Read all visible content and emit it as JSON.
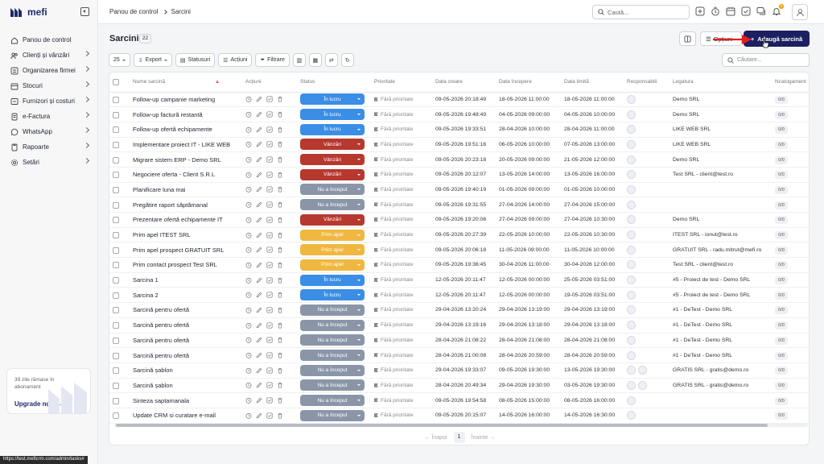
{
  "app": {
    "name": "mefi"
  },
  "sidebar": {
    "items": [
      {
        "label": "Panou de control",
        "icon": "home-icon",
        "chevron": false
      },
      {
        "label": "Clienți și vânzări",
        "icon": "users-icon",
        "chevron": true
      },
      {
        "label": "Organizarea firmei",
        "icon": "org-icon",
        "chevron": true
      },
      {
        "label": "Stocuri",
        "icon": "box-icon",
        "chevron": true
      },
      {
        "label": "Furnizori și costuri",
        "icon": "truck-icon",
        "chevron": true
      },
      {
        "label": "e-Factura",
        "icon": "invoice-icon",
        "chevron": true
      },
      {
        "label": "WhatsApp",
        "icon": "whatsapp-icon",
        "chevron": true
      },
      {
        "label": "Rapoarte",
        "icon": "report-icon",
        "chevron": true
      },
      {
        "label": "Setări",
        "icon": "gear-icon",
        "chevron": true
      }
    ],
    "upgrade": {
      "text": "39 zile rămase în abonament",
      "cta": "Upgrade now"
    }
  },
  "topbar": {
    "breadcrumb": [
      "Panou de control",
      "Sarcini"
    ],
    "search_placeholder": "Caută...",
    "notification_count": "3"
  },
  "page": {
    "title": "Sarcini",
    "count": "22",
    "options_label": "Opțiuni",
    "add_label": "Adaugă sarcină"
  },
  "toolbar": {
    "page_size": "25",
    "export": "Export",
    "statuses": "Statusuri",
    "actions": "Acțiuni",
    "filter": "Filtrare",
    "search_placeholder": "Căutare..."
  },
  "table": {
    "columns": [
      "Nume sarcină",
      "Acțiuni",
      "Status",
      "Prioritate",
      "Data creare",
      "Data începere",
      "Data limită",
      "Responsabili",
      "Legatura",
      "Ncatogament"
    ],
    "rows": [
      {
        "name": "Follow-up campanie marketing",
        "status": "În lucru",
        "st": "lucru",
        "priority": "Fără prioritate",
        "created": "09-05-2026 20:18:49",
        "start": "18-05-2026 11:00:00",
        "due": "18-05-2026 11:00:00",
        "resp": 1,
        "link": "Demo SRL",
        "n": "0/0"
      },
      {
        "name": "Follow-up factură restantă",
        "status": "În lucru",
        "st": "lucru",
        "priority": "Fără prioritate",
        "created": "09-05-2026 19:48:49",
        "start": "04-05-2026 09:00:00",
        "due": "04-05-2026 10:00:00",
        "resp": 1,
        "link": "Demo SRL",
        "n": "0/0"
      },
      {
        "name": "Follow-up ofertă echipamente",
        "status": "În lucru",
        "st": "lucru",
        "priority": "Fără prioritate",
        "created": "09-05-2026 19:33:51",
        "start": "28-04-2026 10:00:00",
        "due": "28-04-2026 11:00:00",
        "resp": 1,
        "link": "LIKE WEB SRL",
        "n": "0/0"
      },
      {
        "name": "Implementare proiect IT - LIKE WEB",
        "status": "Vânzări",
        "st": "vanzari",
        "priority": "Fără prioritate",
        "created": "09-05-2026 19:51:16",
        "start": "06-05-2026 10:00:00",
        "due": "07-05-2026 13:00:00",
        "resp": 1,
        "link": "LIKE WEB SRL",
        "n": "0/0"
      },
      {
        "name": "Migrare sistem ERP - Demo SRL",
        "status": "Vânzări",
        "st": "vanzari",
        "priority": "Fără prioritate",
        "created": "09-05-2026 20:23:18",
        "start": "20-05-2026 09:00:00",
        "due": "21-05-2026 12:00:00",
        "resp": 1,
        "link": "Demo SRL",
        "n": "0/0"
      },
      {
        "name": "Negociere oferta - Client S.R.L",
        "status": "Vânzări",
        "st": "vanzari",
        "priority": "Fără prioritate",
        "created": "09-05-2026 20:12:07",
        "start": "13-05-2026 14:00:00",
        "due": "13-05-2026 16:00:00",
        "resp": 1,
        "link": "Test SRL - client@test.ro",
        "n": "0/0"
      },
      {
        "name": "Planificare luna mai",
        "status": "Nu a început",
        "st": "nuinc",
        "priority": "Fără prioritate",
        "created": "09-05-2026 19:40:19",
        "start": "01-05-2026 09:00:00",
        "due": "01-05-2026 10:00:00",
        "resp": 1,
        "link": "",
        "n": "0/0"
      },
      {
        "name": "Pregătire raport săptămanal",
        "status": "Nu a început",
        "st": "nuinc",
        "priority": "Fără prioritate",
        "created": "09-05-2026 19:31:55",
        "start": "27-04-2026 14:00:00",
        "due": "27-04-2026 15:00:00",
        "resp": 1,
        "link": "",
        "n": "0/0"
      },
      {
        "name": "Prezentare ofertă echipamente IT",
        "status": "Vânzări",
        "st": "vanzari",
        "priority": "Fără prioritate",
        "created": "09-05-2026 19:20:06",
        "start": "27-04-2026 09:00:00",
        "due": "27-04-2026 10:30:00",
        "resp": 1,
        "link": "Demo SRL",
        "n": "0/0"
      },
      {
        "name": "Prim apel ITEST SRL",
        "status": "Prim apel",
        "st": "prim",
        "priority": "Fără prioritate",
        "created": "09-05-2026 20:27:39",
        "start": "22-05-2026 10:00:00",
        "due": "22-05-2026 10:30:00",
        "resp": 1,
        "link": "ITEST SRL - ionut@test.ro",
        "n": "0/0"
      },
      {
        "name": "Prim apel prospect GRATUIT SRL",
        "status": "Prim apel",
        "st": "prim",
        "priority": "Fără prioritate",
        "created": "09-05-2026 20:06:18",
        "start": "11-05-2026 09:00:00",
        "due": "11-05-2026 10:00:00",
        "resp": 1,
        "link": "GRATUIT SRL - radu.mitrut@mefi.ro",
        "n": "0/0"
      },
      {
        "name": "Prim contact prospect Test SRL",
        "status": "Prim apel",
        "st": "prim",
        "priority": "Fără prioritate",
        "created": "09-05-2026 19:36:45",
        "start": "30-04-2026 11:00:00",
        "due": "30-04-2026 12:00:00",
        "resp": 1,
        "link": "Test SRL - client@test.ro",
        "n": "0/0"
      },
      {
        "name": "Sarcina 1",
        "status": "În lucru",
        "st": "lucru",
        "priority": "Fără prioritate",
        "created": "12-05-2026 20:11:47",
        "start": "12-05-2026 00:00:00",
        "due": "25-05-2026 03:51:00",
        "resp": 1,
        "link": "#5 - Proiect de test - Demo SRL",
        "n": "0/0"
      },
      {
        "name": "Sarcina 2",
        "status": "În lucru",
        "st": "lucru",
        "priority": "Fără prioritate",
        "created": "12-05-2026 20:11:47",
        "start": "12-05-2026 00:00:00",
        "due": "19-05-2026 03:51:00",
        "resp": 1,
        "link": "#5 - Proiect de test - Demo SRL",
        "n": "0/0"
      },
      {
        "name": "Sarcină pentru ofertă",
        "status": "Nu a început",
        "st": "nuinc",
        "priority": "Fără prioritate",
        "created": "29-04-2026 13:20:24",
        "start": "29-04-2026 13:19:00",
        "due": "29-04-2026 13:19:00",
        "resp": 1,
        "link": "#1 - DeTest - Demo SRL",
        "n": "0/0"
      },
      {
        "name": "Sarcină pentru ofertă",
        "status": "Nu a început",
        "st": "nuinc",
        "priority": "Fără prioritate",
        "created": "29-04-2026 13:19:16",
        "start": "29-04-2026 13:18:00",
        "due": "29-04-2026 13:18:00",
        "resp": 1,
        "link": "#1 - DeTest - Demo SRL",
        "n": "0/0"
      },
      {
        "name": "Sarcină pentru ofertă",
        "status": "Nu a început",
        "st": "nuinc",
        "priority": "Fără prioritate",
        "created": "28-04-2026 21:08:22",
        "start": "28-04-2026 21:08:00",
        "due": "28-04-2026 21:08:00",
        "resp": 1,
        "link": "#1 - DeTest - Demo SRL",
        "n": "0/0"
      },
      {
        "name": "Sarcină pentru ofertă",
        "status": "Nu a început",
        "st": "nuinc",
        "priority": "Fără prioritate",
        "created": "28-04-2026 21:00:08",
        "start": "28-04-2026 20:59:00",
        "due": "28-04-2026 20:59:00",
        "resp": 1,
        "link": "#1 - DeTest - Demo SRL",
        "n": "0/0"
      },
      {
        "name": "Sarcină șablon",
        "status": "Nu a început",
        "st": "nuinc",
        "priority": "Fără prioritate",
        "created": "29-04-2026 19:33:07",
        "start": "09-05-2026 19:30:00",
        "due": "13-05-2026 19:30:00",
        "resp": 2,
        "link": "GRATIS SRL - gratis@demo.ro",
        "n": "0/0"
      },
      {
        "name": "Sarcină șablon",
        "status": "Nu a început",
        "st": "nuinc",
        "priority": "Fără prioritate",
        "created": "28-04-2026 20:49:34",
        "start": "29-04-2026 19:30:00",
        "due": "03-05-2026 19:30:00",
        "resp": 2,
        "link": "GRATIS SRL - gratis@demo.ro",
        "n": "0/0"
      },
      {
        "name": "Sinteza saptamanala",
        "status": "Nu a început",
        "st": "nuinc",
        "priority": "Fără prioritate",
        "created": "09-05-2026 19:54:58",
        "start": "08-05-2026 15:00:00",
        "due": "08-05-2026 16:00:00",
        "resp": 1,
        "link": "",
        "n": "0/0"
      },
      {
        "name": "Update CRM si curatare e-mail",
        "status": "Nu a început",
        "st": "nuinc",
        "priority": "Fără prioritate",
        "created": "09-05-2026 20:15:07",
        "start": "14-05-2026 16:00:00",
        "due": "14-05-2026 16:30:00",
        "resp": 1,
        "link": "",
        "n": "0/0"
      }
    ]
  },
  "pager": {
    "prev": "← Înapoi",
    "page": "1",
    "next": "Înainte →"
  },
  "statusbar": {
    "url": "https://test.meficrm.com/admin/tasks#"
  },
  "colors": {
    "primary": "#1c2060",
    "in_lucru": "#3a8ee6",
    "vanzari": "#b7382e",
    "nu_inceput": "#8a96a8",
    "prim_apel": "#f0b840",
    "annotation_arrow": "#e02020"
  }
}
